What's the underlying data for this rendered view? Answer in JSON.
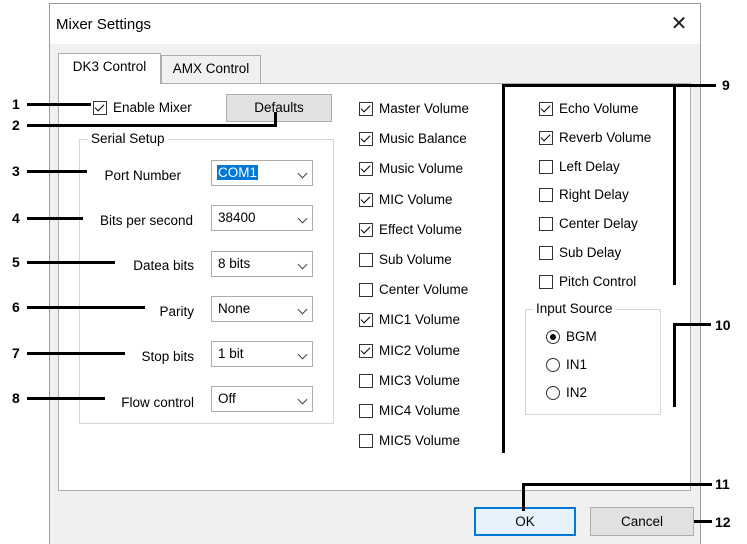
{
  "window": {
    "title": "Mixer Settings"
  },
  "tabs": [
    {
      "label": "DK3 Control",
      "active": true
    },
    {
      "label": "AMX Control",
      "active": false
    }
  ],
  "enable_mixer": {
    "label": "Enable Mixer",
    "checked": true
  },
  "defaults_button": "Defaults",
  "serial_setup": {
    "label": "Serial Setup",
    "fields": [
      {
        "label": "Port Number",
        "value": "COM1"
      },
      {
        "label": "Bits per second",
        "value": "38400"
      },
      {
        "label": "Datea bits",
        "value": "8 bits"
      },
      {
        "label": "Parity",
        "value": "None"
      },
      {
        "label": "Stop bits",
        "value": "1 bit"
      },
      {
        "label": "Flow control",
        "value": "Off"
      }
    ]
  },
  "volumes_col1": [
    {
      "label": "Master Volume",
      "checked": true
    },
    {
      "label": "Music Balance",
      "checked": true
    },
    {
      "label": "Music Volume",
      "checked": true
    },
    {
      "label": "MIC Volume",
      "checked": true
    },
    {
      "label": "Effect Volume",
      "checked": true
    },
    {
      "label": "Sub Volume",
      "checked": false
    },
    {
      "label": "Center Volume",
      "checked": false
    },
    {
      "label": "MIC1 Volume",
      "checked": true
    },
    {
      "label": "MIC2 Volume",
      "checked": true
    },
    {
      "label": "MIC3 Volume",
      "checked": false
    },
    {
      "label": "MIC4 Volume",
      "checked": false
    },
    {
      "label": "MIC5 Volume",
      "checked": false
    }
  ],
  "volumes_col2": [
    {
      "label": "Echo Volume",
      "checked": true
    },
    {
      "label": "Reverb Volume",
      "checked": true
    },
    {
      "label": "Left Delay",
      "checked": false
    },
    {
      "label": "Right Delay",
      "checked": false
    },
    {
      "label": "Center Delay",
      "checked": false
    },
    {
      "label": "Sub Delay",
      "checked": false
    },
    {
      "label": "Pitch Control",
      "checked": false
    }
  ],
  "input_source": {
    "label": "Input Source",
    "options": [
      {
        "label": "BGM",
        "selected": true
      },
      {
        "label": "IN1",
        "selected": false
      },
      {
        "label": "IN2",
        "selected": false
      }
    ]
  },
  "buttons": {
    "ok": "OK",
    "cancel": "Cancel"
  },
  "callouts": [
    "1",
    "2",
    "3",
    "4",
    "5",
    "6",
    "7",
    "8",
    "9",
    "10",
    "11",
    "12"
  ],
  "colors": {
    "accent": "#0078d7",
    "dialog_bg": "#f0f0f0",
    "panel_bg": "#ffffff"
  }
}
